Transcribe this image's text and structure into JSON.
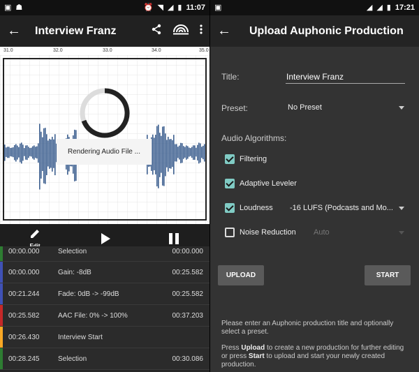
{
  "left": {
    "status": {
      "time": "11:07"
    },
    "appbar": {
      "title": "Interview Franz",
      "share_icon": "share-icon",
      "auphonic_icon": "auphonic-logo-icon",
      "overflow_icon": "more-vert-icon"
    },
    "ruler": {
      "ticks": [
        "31.0",
        "32.0",
        "33.0",
        "34.0",
        "35.0"
      ]
    },
    "rendering_text": "Rendering Audio File ...",
    "controls": {
      "edit_label": "Edit"
    },
    "rows": [
      {
        "start": "00:00.000",
        "label": "Selection",
        "end": "00:00.000",
        "color": "#2e7d32"
      },
      {
        "start": "00:00.000",
        "label": "Gain: -8dB",
        "end": "00:25.582",
        "color": "#3f51b5"
      },
      {
        "start": "00:21.244",
        "label": "Fade: 0dB -> -99dB",
        "end": "00:25.582",
        "color": "#3f51b5"
      },
      {
        "start": "00:25.582",
        "label": "AAC File: 0% -> 100%",
        "end": "00:37.203",
        "color": "#c62828"
      },
      {
        "start": "00:26.430",
        "label": "Interview Start",
        "end": "",
        "color": "#f9a825"
      },
      {
        "start": "00:28.245",
        "label": "Selection",
        "end": "00:30.086",
        "color": "#2e7d32"
      }
    ]
  },
  "right": {
    "status": {
      "time": "17:21"
    },
    "appbar": {
      "title": "Upload Auphonic Production"
    },
    "form": {
      "title_label": "Title:",
      "title_value": "Interview Franz",
      "preset_label": "Preset:",
      "preset_value": "No Preset",
      "algorithms_label": "Audio Algorithms:",
      "filtering": "Filtering",
      "leveler": "Adaptive Leveler",
      "loudness": "Loudness",
      "loudness_value": "-16 LUFS (Podcasts and Mo...",
      "noise": "Noise Reduction",
      "noise_value": "Auto"
    },
    "buttons": {
      "upload": "UPLOAD",
      "start": "START"
    },
    "help": {
      "p1": "Please enter an Auphonic production title and optionally select a preset.",
      "p2_a": "Press ",
      "p2_upload": "Upload",
      "p2_b": " to create a new production for further editing or press ",
      "p2_start": "Start",
      "p2_c": " to upload and start your newly created production."
    }
  }
}
